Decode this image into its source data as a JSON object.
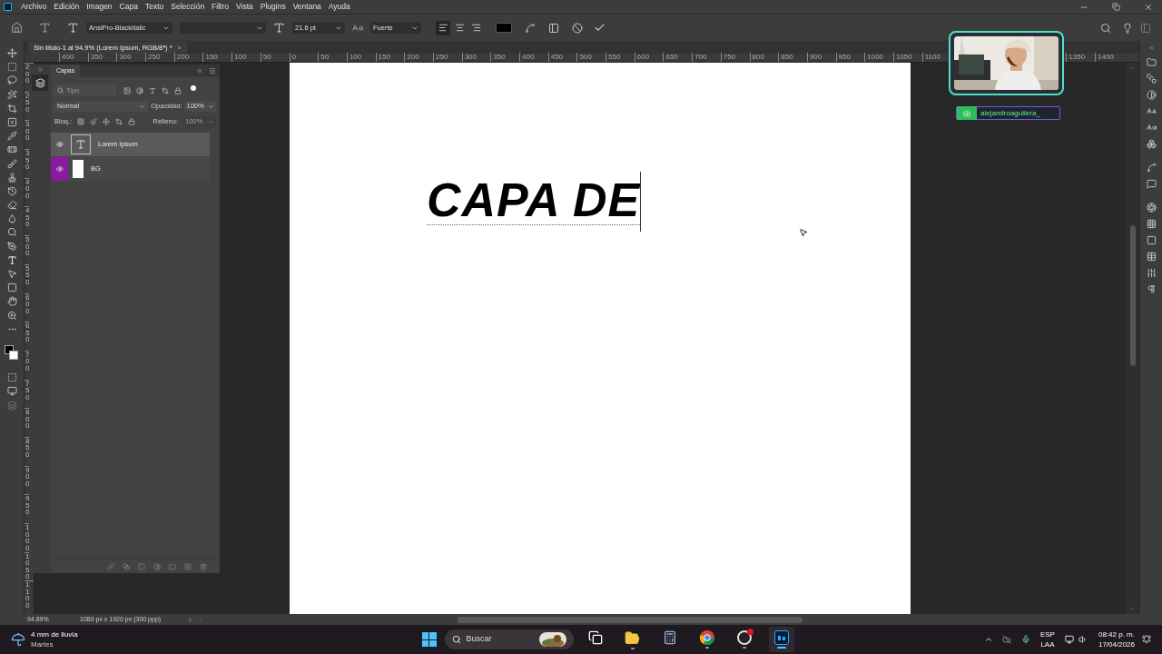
{
  "menu": [
    "Archivo",
    "Edición",
    "Imagen",
    "Capa",
    "Texto",
    "Selección",
    "Filtro",
    "Vista",
    "Plugins",
    "Ventana",
    "Ayuda"
  ],
  "options_bar": {
    "font_family": "AnsiPro-BlackItalic",
    "font_size": "21.6 pt",
    "antialias": "Fuerte",
    "alignment": [
      {
        "kind": "left",
        "selected": true
      },
      {
        "kind": "center",
        "selected": false
      },
      {
        "kind": "right",
        "selected": false
      }
    ]
  },
  "document_tab": {
    "title": "Sin título-1 al 94.9% (Lorem Ipsum, RGB/8*) *",
    "close": "×"
  },
  "ruler": {
    "top_labels": [
      "400",
      "350",
      "300",
      "250",
      "200",
      "150",
      "100",
      "50",
      "0",
      "50",
      "100",
      "150",
      "200",
      "250",
      "300",
      "350",
      "400",
      "450",
      "500",
      "550",
      "600",
      "650",
      "700",
      "750",
      "800",
      "850",
      "900",
      "950",
      "1000",
      "1050",
      "1100"
    ],
    "top_right_labels": [
      "1350",
      "1400"
    ],
    "left_labels": [
      "200",
      "250",
      "300",
      "350",
      "400",
      "450",
      "500",
      "550",
      "600",
      "650",
      "700",
      "750",
      "800",
      "850",
      "900",
      "950",
      "1000",
      "1050",
      "1100"
    ]
  },
  "layers_panel": {
    "tab": "Capas",
    "filter_placeholder": "Tipo",
    "blend_mode": "Normal",
    "opacity_label": "Opacidad:",
    "opacity": "100%",
    "lock_label": "Bloq.:",
    "fill_label": "Relleno:",
    "fill": "100%",
    "fill_disabled": true,
    "layers": [
      {
        "name": "Lorem Ipsum",
        "kind": "text",
        "selected": true,
        "visible": true,
        "highlighted": false
      },
      {
        "name": "BG",
        "kind": "fill",
        "selected": false,
        "visible": true,
        "highlighted": true
      }
    ]
  },
  "canvas": {
    "text": "CAPA DE"
  },
  "webcam": {
    "username": "alejandroaguilera_"
  },
  "status_bar": {
    "zoom": "94.89%",
    "document_size": "1080 px x 1920 px (300 ppp)"
  },
  "taskbar": {
    "weather": "4 mm de lluvia",
    "day": "Martes",
    "search_placeholder": "Buscar",
    "apps": [
      {
        "kind": "taskview",
        "active": false,
        "running": false
      },
      {
        "kind": "files",
        "active": false,
        "running": true
      },
      {
        "kind": "calculator",
        "active": false,
        "running": false
      },
      {
        "kind": "browser",
        "active": false,
        "running": true
      },
      {
        "kind": "recorder",
        "active": false,
        "running": true
      },
      {
        "kind": "photoshop",
        "active": true,
        "running": true
      }
    ],
    "language": "ESP",
    "region": "LAA",
    "time": "08:42 p. m.",
    "date": "17/04/2026"
  }
}
